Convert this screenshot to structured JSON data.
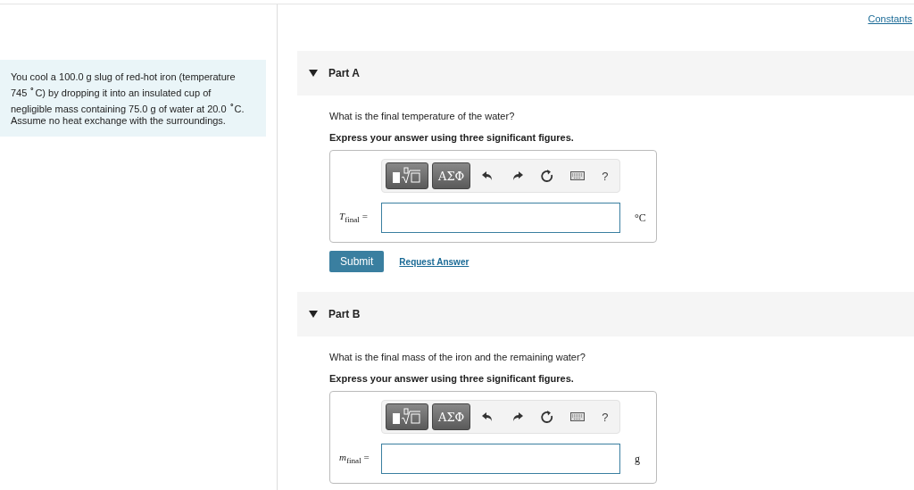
{
  "intro": "You cool a 100.0 g slug of red-hot iron (temperature 745 $^{∘}$C) by dropping it into an insulated cup of negligible mass containing 75.0 g of water at 20.0 $^{∘}$C. Assume no heat exchange with the surroundings.",
  "constants_link": "Constants",
  "parts": [
    {
      "title": "Part A",
      "expanded": true,
      "question": "What is the final temperature of the water?",
      "instruction": "Express your answer using three significant figures.",
      "toolbar": {
        "symbols": "ΑΣΦ",
        "help": "?"
      },
      "label": "*T*$_{final}$ =",
      "unit": "°C",
      "submit": "Submit",
      "request": "Request Answer"
    },
    {
      "title": "Part B",
      "expanded": true,
      "question": "What is the final mass of the iron and the remaining water?",
      "instruction": "Express your answer using three significant figures.",
      "toolbar": {
        "symbols": "ΑΣΦ",
        "help": "?"
      },
      "label": "*m*$_{final}$ =",
      "unit": "g"
    }
  ]
}
